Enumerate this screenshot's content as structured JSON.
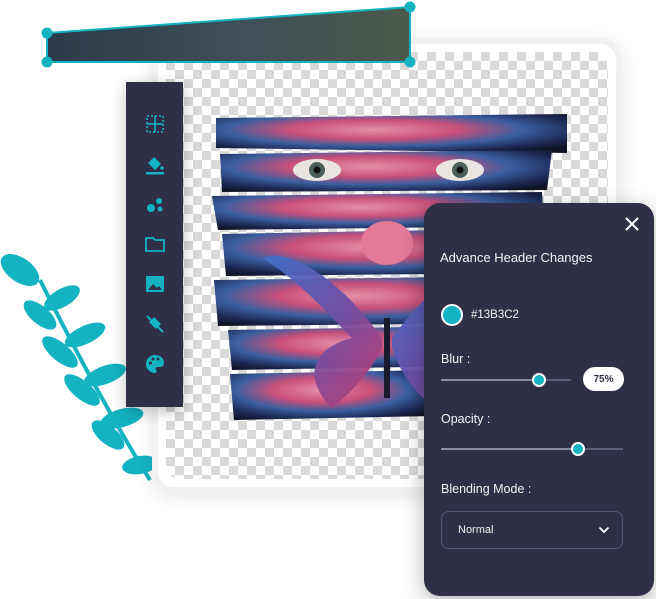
{
  "panel": {
    "title": "Advance Header Changes",
    "color_hex": "#13B3C2",
    "blur_label": "Blur :",
    "blur_value": "75%",
    "blur_level": 0.75,
    "opacity_label": "Opacity :",
    "opacity_level": 0.75,
    "blending_label": "Blending Mode :",
    "blending_value": "Normal"
  },
  "toolbar": {
    "tools": [
      "grid-icon",
      "fill-bucket-icon",
      "shapes-icon",
      "folder-icon",
      "image-icon",
      "no-fill-icon",
      "palette-icon"
    ]
  },
  "colors": {
    "accent": "#13B3C2",
    "panel_bg": "#2f2f47",
    "toolbar_bg": "#2f2f47"
  }
}
